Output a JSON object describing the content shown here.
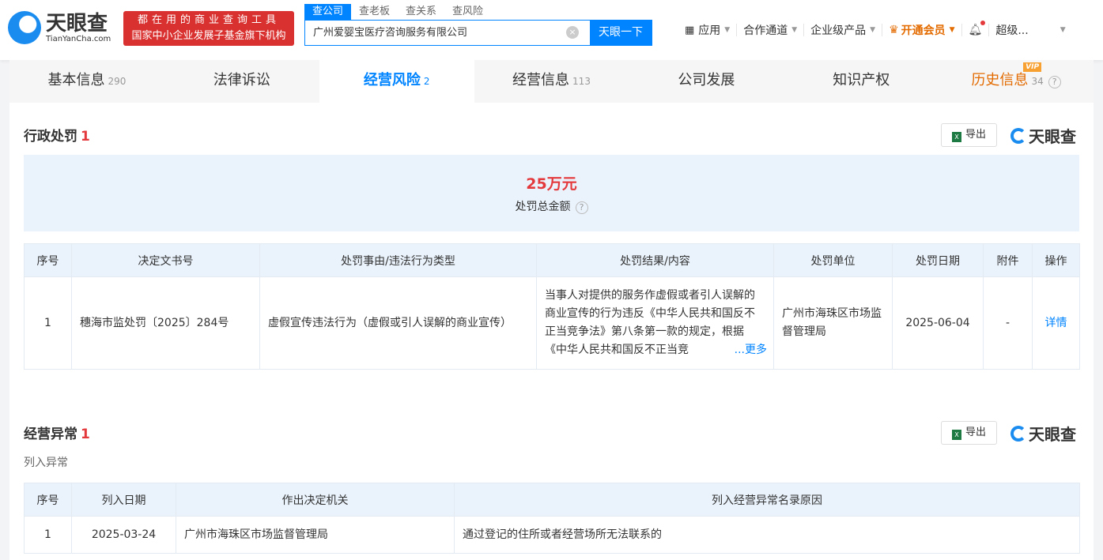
{
  "header": {
    "logo_cn": "天眼查",
    "logo_en": "TianYanCha.com",
    "slogan1": "都在用的商业查询工具",
    "slogan2": "国家中小企业发展子基金旗下机构",
    "search_tabs": [
      "查公司",
      "查老板",
      "查关系",
      "查风险"
    ],
    "search_value": "广州爱婴宝医疗咨询服务有限公司",
    "search_button": "天眼一下",
    "nav": {
      "apps": "应用",
      "channel": "合作通道",
      "enterprise": "企业级产品",
      "vip": "开通会员",
      "user": "超级..."
    }
  },
  "tabs": [
    {
      "label": "基本信息",
      "count": "290"
    },
    {
      "label": "法律诉讼",
      "count": ""
    },
    {
      "label": "经营风险",
      "count": "2"
    },
    {
      "label": "经营信息",
      "count": "113"
    },
    {
      "label": "公司发展",
      "count": ""
    },
    {
      "label": "知识产权",
      "count": ""
    },
    {
      "label": "历史信息",
      "count": "34",
      "badge": "VIP"
    }
  ],
  "penalty": {
    "title": "行政处罚",
    "count": "1",
    "export": "导出",
    "brand": "天眼查",
    "amount": "25万元",
    "amount_label": "处罚总金额",
    "columns": [
      "序号",
      "决定文书号",
      "处罚事由/违法行为类型",
      "处罚结果/内容",
      "处罚单位",
      "处罚日期",
      "附件",
      "操作"
    ],
    "rows": [
      {
        "no": "1",
        "doc": "穗海市监处罚〔2025〕284号",
        "reason": "虚假宣传违法行为（虚假或引人误解的商业宣传）",
        "result": "当事人对提供的服务作虚假或者引人误解的商业宣传的行为违反《中华人民共和国反不正当竞争法》第八条第一款的规定，根据《中华人民共和国反不正当竞",
        "more": "...更多",
        "unit": "广州市海珠区市场监督管理局",
        "date": "2025-06-04",
        "attach": "-",
        "action": "详情"
      }
    ]
  },
  "abnormal": {
    "title": "经营异常",
    "count": "1",
    "export": "导出",
    "brand": "天眼查",
    "subtitle": "列入异常",
    "columns": [
      "序号",
      "列入日期",
      "作出决定机关",
      "列入经营异常名录原因"
    ],
    "rows": [
      {
        "no": "1",
        "date": "2025-03-24",
        "authority": "广州市海珠区市场监督管理局",
        "reason": "通过登记的住所或者经营场所无法联系的"
      }
    ]
  }
}
